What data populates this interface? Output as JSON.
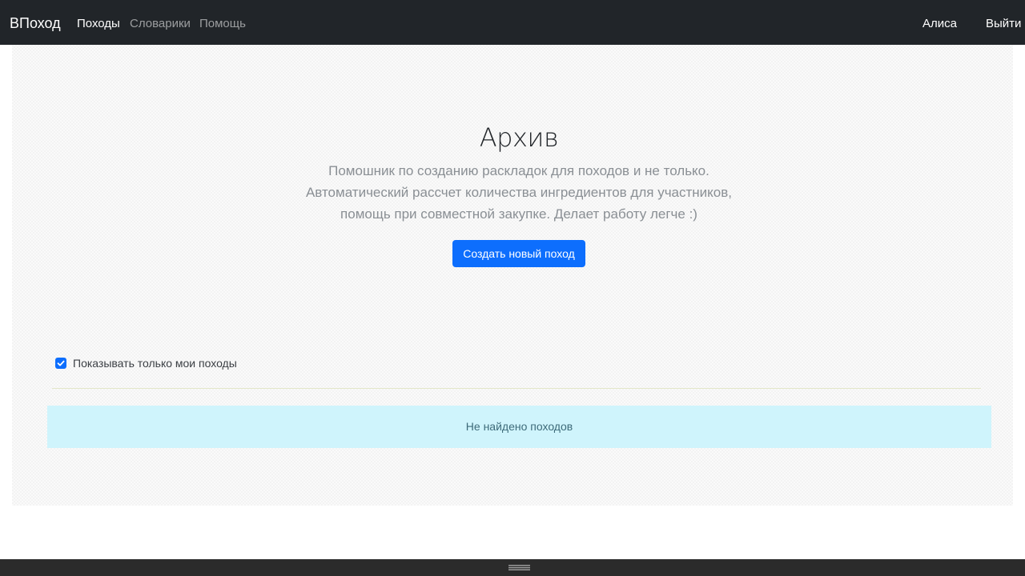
{
  "navbar": {
    "brand": "ВПоход",
    "links": [
      {
        "label": "Походы",
        "active": true
      },
      {
        "label": "Словарики",
        "active": false
      },
      {
        "label": "Помощь",
        "active": false
      }
    ],
    "user": "Алиса",
    "logout": "Выйти"
  },
  "hero": {
    "title": "Архив",
    "lead_lines": [
      "Помошник по созданию раскладок для походов и не только.",
      "Автоматический рассчет количества ингредиентов для участников,",
      "помощь при совместной закупке. Делает работу легче :)"
    ],
    "create_button": "Создать новый поход"
  },
  "filter": {
    "only_mine_label": "Показывать только мои походы",
    "only_mine_checked": true
  },
  "results": {
    "empty_message": "Не найдено походов"
  },
  "colors": {
    "navbar_bg": "#212529",
    "primary": "#0d6efd",
    "alert_bg": "#cff4fc"
  }
}
